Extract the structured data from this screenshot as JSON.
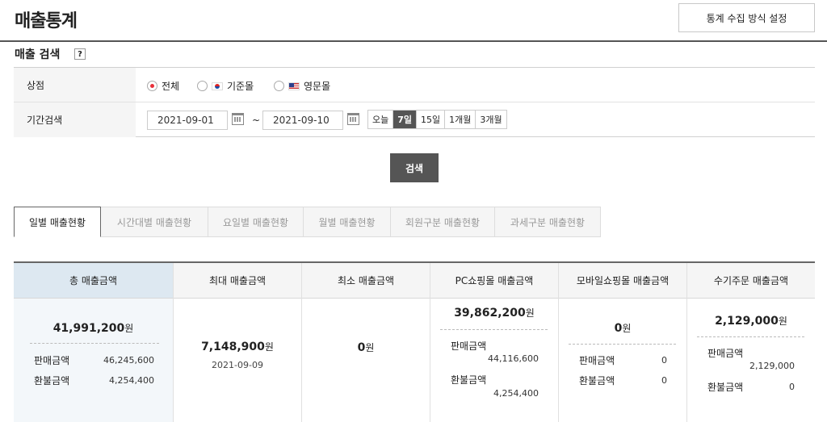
{
  "header": {
    "title": "매출통계",
    "settings_button": "통계 수집 방식 설정"
  },
  "search": {
    "title": "매출 검색",
    "help_icon": "?",
    "store_label": "상점",
    "store_options": [
      "전체",
      "기준몰",
      "영문몰"
    ],
    "store_selected": "전체",
    "period_label": "기간검색",
    "date_from": "2021-09-01",
    "date_to": "2021-09-10",
    "tilde": "~",
    "period_buttons": [
      "오늘",
      "7일",
      "15일",
      "1개월",
      "3개월"
    ],
    "period_active": "7일",
    "search_button": "검색"
  },
  "tabs": [
    "일별 매출현황",
    "시간대별 매출현황",
    "요일별 매출현황",
    "월별 매출현황",
    "회원구분 매출현황",
    "과세구분 매출현황"
  ],
  "active_tab": "일별 매출현황",
  "stats": {
    "unit": "원",
    "sales_label": "판매금액",
    "refund_label": "환불금액",
    "total": {
      "header": "총 매출금액",
      "value": "41,991,200",
      "sales": "46,245,600",
      "refund": "4,254,400"
    },
    "max": {
      "header": "최대 매출금액",
      "value": "7,148,900",
      "date": "2021-09-09"
    },
    "min": {
      "header": "최소 매출금액",
      "value": "0"
    },
    "pc": {
      "header": "PC쇼핑몰 매출금액",
      "value": "39,862,200",
      "sales": "44,116,600",
      "refund": "4,254,400"
    },
    "mobile": {
      "header": "모바일쇼핑몰 매출금액",
      "value": "0",
      "sales": "0",
      "refund": "0"
    },
    "manual": {
      "header": "수기주문 매출금액",
      "value": "2,129,000",
      "sales": "2,129,000",
      "refund": "0"
    }
  }
}
